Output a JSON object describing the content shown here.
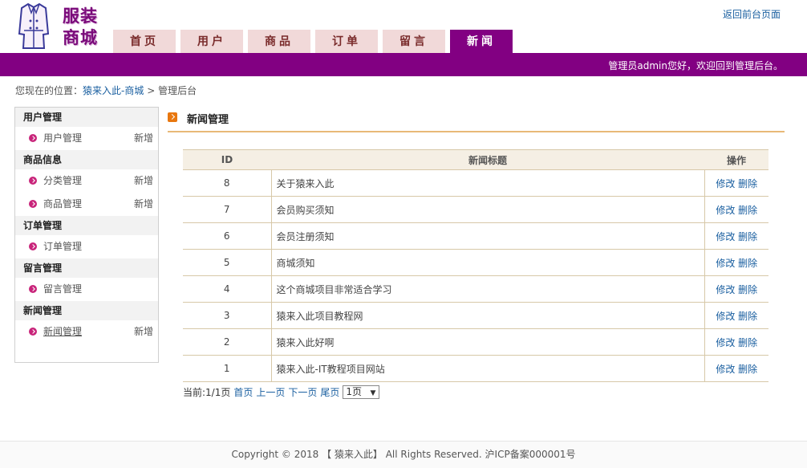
{
  "logo": {
    "line1": "服装",
    "line2": "商城",
    "icon": "coat-icon"
  },
  "header": {
    "back_link": "返回前台页面"
  },
  "nav": [
    {
      "label": "首页",
      "active": false
    },
    {
      "label": "用户",
      "active": false
    },
    {
      "label": "商品",
      "active": false
    },
    {
      "label": "订单",
      "active": false
    },
    {
      "label": "留言",
      "active": false
    },
    {
      "label": "新闻",
      "active": true
    }
  ],
  "welcome": "管理员admin您好，欢迎回到管理后台。",
  "breadcrumb": {
    "prefix": "您现在的位置：",
    "link": "猿来入此-商城",
    "sep": ">",
    "current": "管理后台"
  },
  "sidebar": {
    "groups": [
      {
        "title": "用户管理",
        "items": [
          {
            "label": "用户管理",
            "add": "新增"
          }
        ]
      },
      {
        "title": "商品信息",
        "items": [
          {
            "label": "分类管理",
            "add": "新增"
          },
          {
            "label": "商品管理",
            "add": "新增"
          }
        ]
      },
      {
        "title": "订单管理",
        "items": [
          {
            "label": "订单管理",
            "add": ""
          }
        ]
      },
      {
        "title": "留言管理",
        "items": [
          {
            "label": "留言管理",
            "add": ""
          }
        ]
      },
      {
        "title": "新闻管理",
        "items": [
          {
            "label": "新闻管理",
            "add": "新增"
          }
        ]
      }
    ]
  },
  "main": {
    "title": "新闻管理"
  },
  "table": {
    "headers": [
      "ID",
      "新闻标题",
      "操作"
    ],
    "edit_label": "修改",
    "delete_label": "删除",
    "rows": [
      {
        "id": "8",
        "title": "关于猿来入此"
      },
      {
        "id": "7",
        "title": "会员购买须知"
      },
      {
        "id": "6",
        "title": "会员注册须知"
      },
      {
        "id": "5",
        "title": "商城须知"
      },
      {
        "id": "4",
        "title": "这个商城项目非常适合学习"
      },
      {
        "id": "3",
        "title": "猿来入此项目教程网"
      },
      {
        "id": "2",
        "title": "猿来入此好啊"
      },
      {
        "id": "1",
        "title": "猿来入此-IT教程项目网站"
      }
    ]
  },
  "pager": {
    "current": "当前:1/1页",
    "first": "首页",
    "prev": "上一页",
    "next": "下一页",
    "last": "尾页",
    "select_value": "1页"
  },
  "footer": "Copyright © 2018 【 猿来入此】 All Rights Reserved. 沪ICP备案000001号",
  "colors": {
    "brand": "#820082",
    "tab_bg": "#f1d9d9",
    "link": "#1a5fa0"
  }
}
